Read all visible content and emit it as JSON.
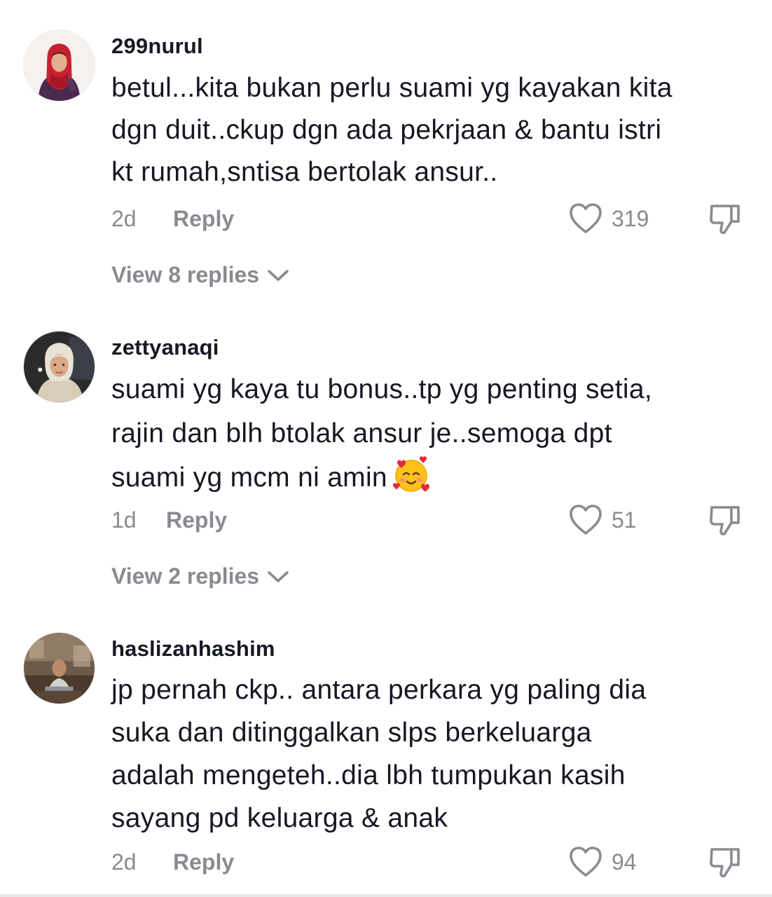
{
  "comments": [
    {
      "username": "299nurul",
      "text_lines": [
        "betul...kita bukan perlu suami yg kayakan kita",
        "dgn duit..ckup dgn ada pekrjaan & bantu istri",
        "kt rumah,sntisa bertolak ansur.."
      ],
      "time": "2d",
      "reply_label": "Reply",
      "likes": "319",
      "view_replies": "View 8 replies",
      "avatar_icon": "avatar-hijab-red"
    },
    {
      "username": "zettyanaqi",
      "text_lines": [
        "suami yg kaya tu bonus..tp yg penting setia,",
        "rajin dan blh btolak ansur je..semoga dpt",
        "suami yg mcm ni amin"
      ],
      "emoji": "smiling-face-with-hearts",
      "time": "1d",
      "reply_label": "Reply",
      "likes": "51",
      "view_replies": "View 2 replies",
      "avatar_icon": "avatar-beige-hijab"
    },
    {
      "username": "haslizanhashim",
      "text_lines": [
        "jp pernah ckp.. antara perkara yg paling dia",
        "suka dan ditinggalkan slps berkeluarga",
        "adalah mengeteh..dia lbh tumpukan kasih",
        "sayang pd keluarga & anak"
      ],
      "time": "2d",
      "reply_label": "Reply",
      "likes": "94",
      "avatar_icon": "avatar-man-photo"
    }
  ],
  "icons": {
    "like": "heart-outline-icon",
    "dislike": "thumbs-down-icon",
    "expand": "chevron-down-icon"
  },
  "colors": {
    "primary_text": "#161823",
    "secondary_text": "#8a8b91"
  }
}
